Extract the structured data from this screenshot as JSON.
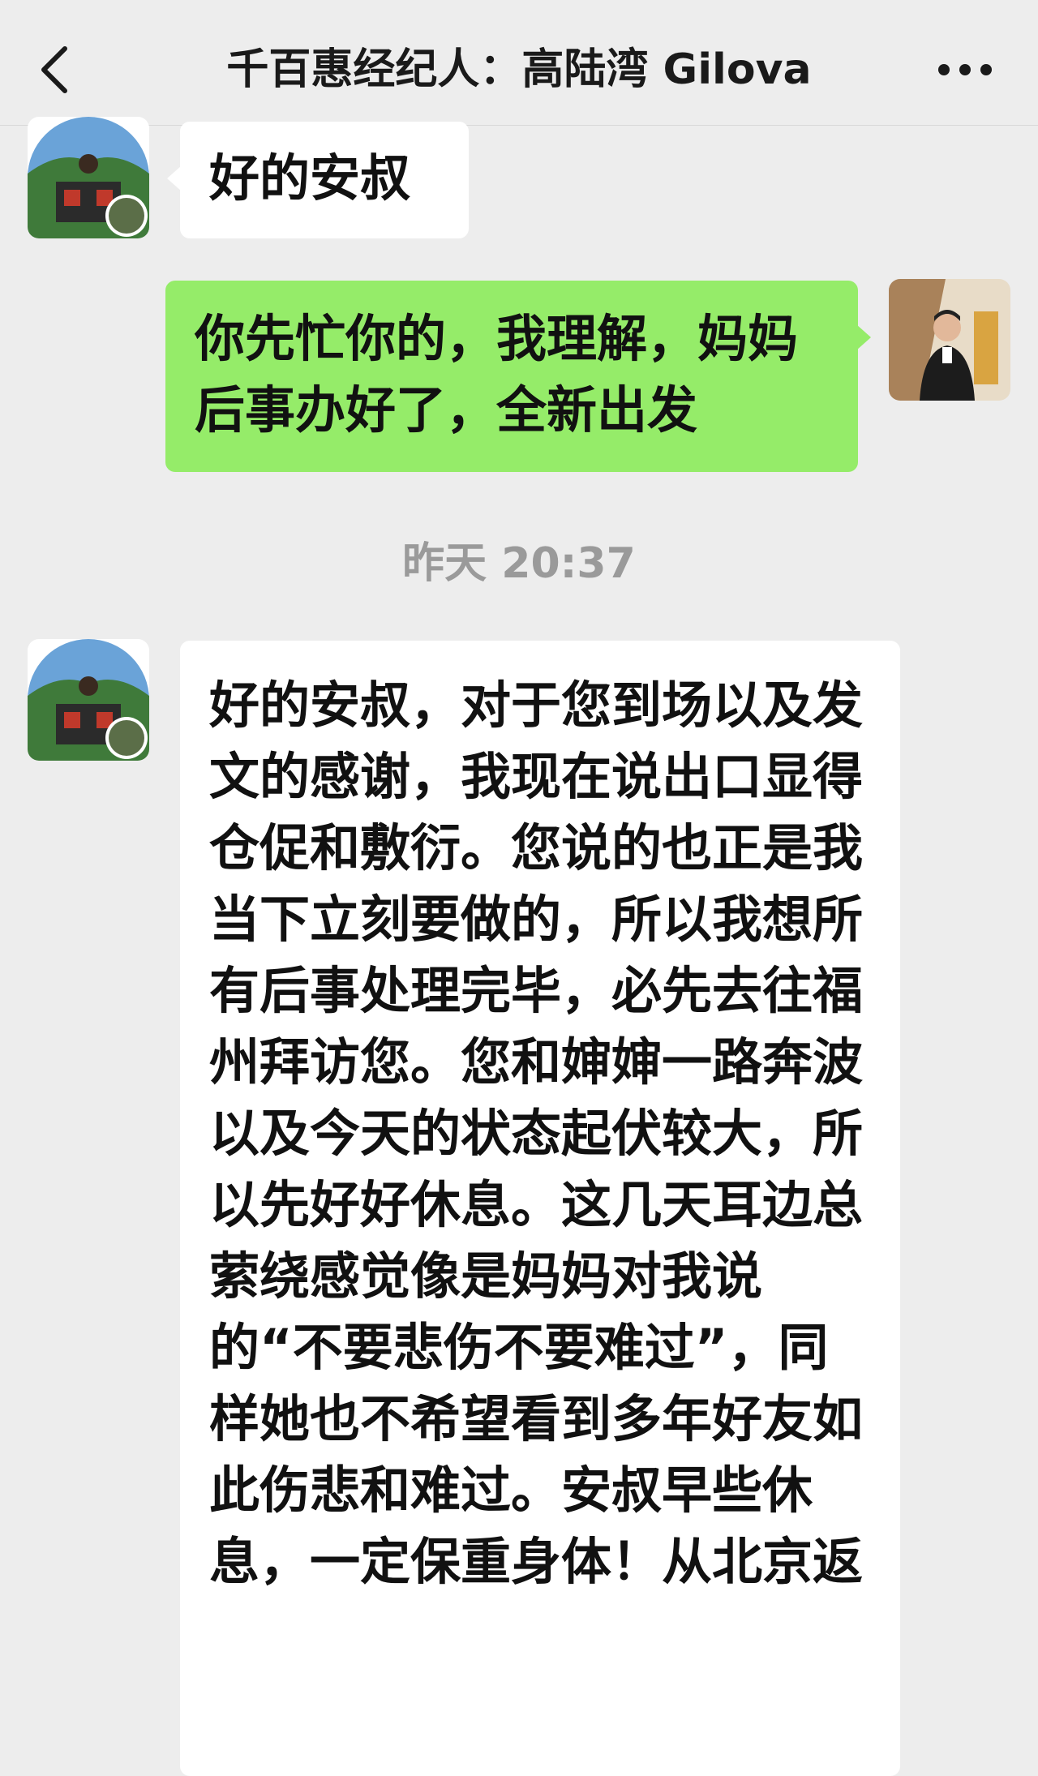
{
  "header": {
    "title": "千百惠经纪人：高陆湾 Gilova",
    "back_icon": "chevron-left-icon",
    "more_icon": "more-icon"
  },
  "messages": [
    {
      "side": "left",
      "text": "好的安叔"
    },
    {
      "side": "right",
      "text": "你先忙你的，我理解，妈妈后事办好了，全新出发"
    },
    {
      "side": "left",
      "text": "好的安叔，对于您到场以及发文的感谢，我现在说出口显得仓促和敷衍。您说的也正是我当下立刻要做的，所以我想所有后事处理完毕，必先去往福州拜访您。您和婶婶一路奔波以及今天的状态起伏较大，所以先好好休息。这几天耳边总萦绕感觉像是妈妈对我说的“不要悲伤不要难过”，同样她也不希望看到多年好友如此伤悲和难过。安叔早些休息，一定保重身体！从北京返"
    }
  ],
  "timestamp": "昨天 20:37",
  "colors": {
    "background": "#ededed",
    "bubble_self": "#95ec69",
    "bubble_other": "#ffffff",
    "timestamp_text": "#9a9a9a"
  }
}
